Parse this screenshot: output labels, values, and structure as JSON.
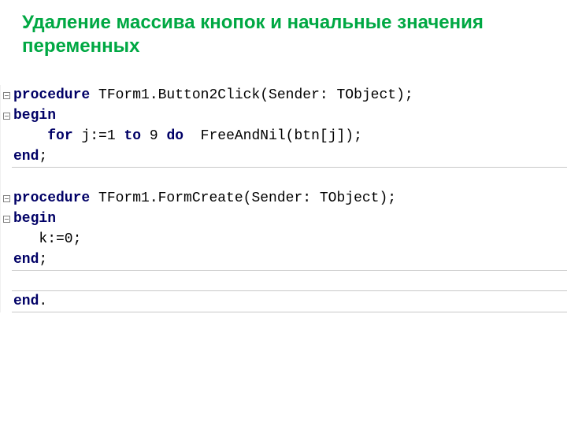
{
  "title": "Удаление массива кнопок и начальные значения переменных",
  "code": {
    "line1_kw": "procedure",
    "line1_rest": " TForm1.Button2Click(Sender: TObject);",
    "line2_kw": "begin",
    "line3_a": "    ",
    "line3_kw1": "for",
    "line3_b": " j:=1 ",
    "line3_kw2": "to",
    "line3_c": " 9 ",
    "line3_kw3": "do",
    "line3_d": "  FreeAndNil(btn[j]);",
    "line4_kw": "end",
    "line4_s": ";",
    "line5_kw": "procedure",
    "line5_rest": " TForm1.FormCreate(Sender: TObject);",
    "line6_kw": "begin",
    "line7": "   k:=0;",
    "line8_kw": "end",
    "line8_s": ";",
    "line9_kw": "end",
    "line9_s": "."
  }
}
